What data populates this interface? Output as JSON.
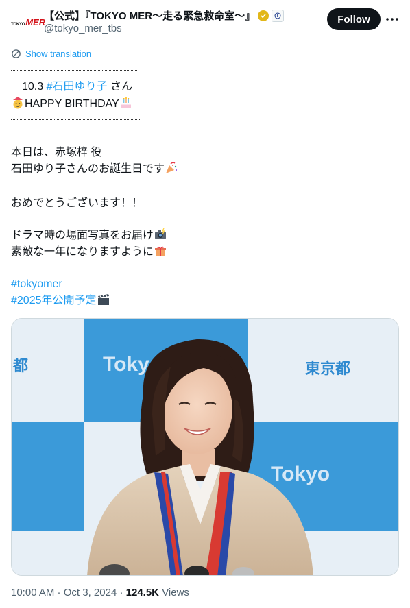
{
  "header": {
    "avatar_logo": "TOKYO MER",
    "display_name": "【公式】『TOKYO MER〜走る緊急救命室〜』",
    "handle": "@tokyo_mer_tbs",
    "follow_label": "Follow",
    "more_label": "···",
    "verified_icon": "gold-verified-badge-icon",
    "affiliate_icon": "affiliate-badge-icon"
  },
  "translation": {
    "label": "Show translation",
    "icon": "translate-icon"
  },
  "tweet": {
    "line1_prefix": "10.3 ",
    "line1_tag": "#石田ゆり子",
    "line1_suffix": " さん",
    "line2": "HAPPY BIRTHDAY",
    "line3": "本日は、赤塚梓 役",
    "line4": "石田ゆり子さんのお誕生日です",
    "line5": "おめでとうございます！！",
    "line6": "ドラマ時の場面写真をお届け",
    "line7": "素敵な一年になりますように",
    "hashtag1": "#tokyomer",
    "hashtag2": "#2025年公開予定"
  },
  "photo": {
    "backdrop_text_1": "Tokyo",
    "backdrop_text_2": "東京都",
    "backdrop_text_3": "Tokyo",
    "backdrop_text_4": "都",
    "colors": {
      "blue": "#3b9ad9",
      "light": "#e6eef5"
    }
  },
  "footer": {
    "time": "10:00 AM",
    "date": "Oct 3, 2024",
    "views_count": "124.5K",
    "views_label": "Views"
  },
  "colors": {
    "link": "#1d9bf0",
    "text": "#0f1419",
    "secondary": "#536471"
  }
}
